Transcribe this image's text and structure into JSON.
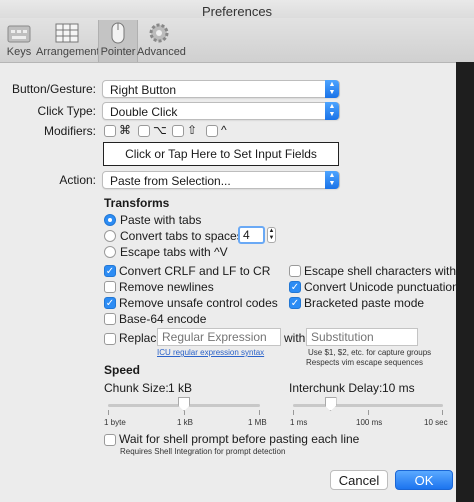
{
  "window": {
    "title": "Preferences"
  },
  "toolbar": {
    "items": [
      {
        "label": "Keys",
        "icon": "keyboard-icon"
      },
      {
        "label": "Arrangements",
        "icon": "grid-icon"
      },
      {
        "label": "Pointer",
        "icon": "mouse-icon"
      },
      {
        "label": "Advanced",
        "icon": "gear-icon"
      }
    ],
    "selected": "Pointer"
  },
  "form": {
    "button_label": "Button/Gesture:",
    "button_value": "Right Button",
    "click_label": "Click Type:",
    "click_value": "Double Click",
    "modifiers_label": "Modifiers:",
    "modifiers": [
      "⌘",
      "⌥",
      "⇧",
      "^"
    ],
    "input_fields_button": "Click or Tap Here to Set Input Fields",
    "action_label": "Action:",
    "action_value": "Paste from Selection..."
  },
  "transforms": {
    "heading": "Transforms",
    "paste_tabs": "Paste with tabs",
    "convert_tabs": "Convert tabs to spaces:",
    "spaces_value": "4",
    "escape_tabs": "Escape tabs with ^V",
    "crlf": "Convert CRLF and LF to CR",
    "escape_shell": "Escape shell characters with \\",
    "remove_newlines": "Remove newlines",
    "unicode": "Convert Unicode punctuation",
    "remove_unsafe": "Remove unsafe control codes",
    "bracketed": "Bracketed paste mode",
    "base64": "Base-64 encode",
    "replace": "Replace",
    "regex_placeholder": "Regular Expression",
    "with": "with",
    "subst_placeholder": "Substitution",
    "icu_link": "ICU regular expression syntax",
    "capture_hint1": "Use $1, $2, etc. for capture groups",
    "capture_hint2": "Respects vim escape sequences"
  },
  "speed": {
    "heading": "Speed",
    "chunk_label": "Chunk Size:",
    "chunk_value": "1 kB",
    "chunk_ticks": [
      "1 byte",
      "1 kB",
      "1 MB"
    ],
    "chunk_fraction": 0.5,
    "delay_label": "Interchunk Delay:",
    "delay_value": "10 ms",
    "delay_ticks": [
      "1 ms",
      "100 ms",
      "10 sec"
    ],
    "delay_fraction": 0.25,
    "wait_label": "Wait for shell prompt before pasting each line",
    "wait_hint": "Requires Shell Integration for prompt detection"
  },
  "buttons": {
    "cancel": "Cancel",
    "ok": "OK"
  },
  "colors": {
    "accent": "#2c8cf4",
    "link": "#2a62c9"
  }
}
